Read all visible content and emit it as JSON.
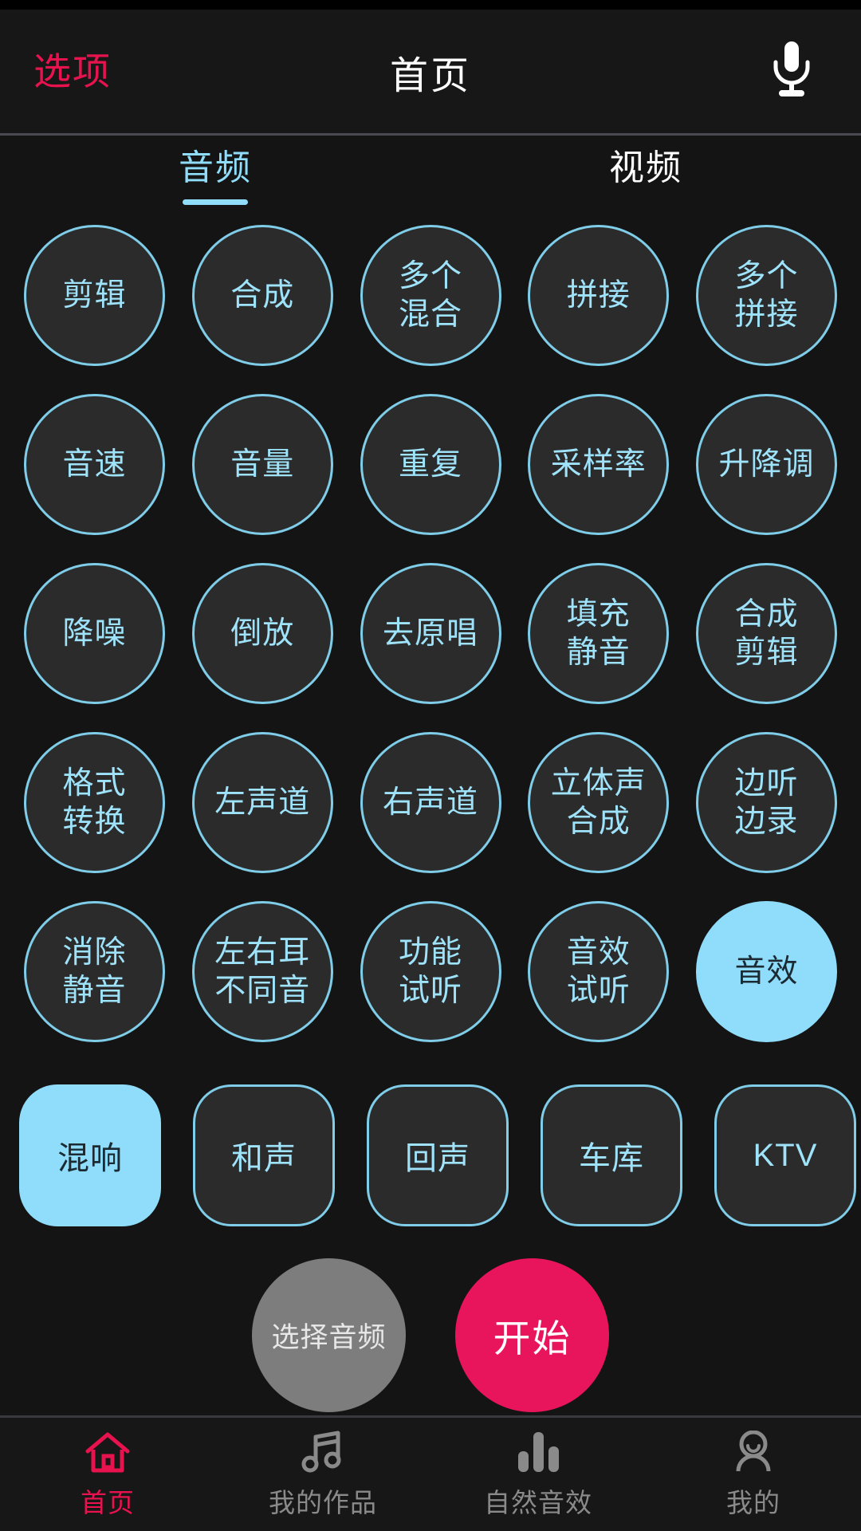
{
  "header": {
    "left_label": "选项",
    "title": "首页",
    "mic_icon": "microphone-icon",
    "options_color": "#E8134E"
  },
  "tabs": [
    {
      "label": "音频",
      "active": true
    },
    {
      "label": "视频",
      "active": false
    }
  ],
  "grid": {
    "rows": [
      [
        {
          "label": "剪辑",
          "selected": false
        },
        {
          "label": "合成",
          "selected": false
        },
        {
          "label": "多个\n混合",
          "selected": false
        },
        {
          "label": "拼接",
          "selected": false
        },
        {
          "label": "多个\n拼接",
          "selected": false
        }
      ],
      [
        {
          "label": "音速",
          "selected": false
        },
        {
          "label": "音量",
          "selected": false
        },
        {
          "label": "重复",
          "selected": false
        },
        {
          "label": "采样率",
          "selected": false
        },
        {
          "label": "升降调",
          "selected": false
        }
      ],
      [
        {
          "label": "降噪",
          "selected": false
        },
        {
          "label": "倒放",
          "selected": false
        },
        {
          "label": "去原唱",
          "selected": false
        },
        {
          "label": "填充\n静音",
          "selected": false
        },
        {
          "label": "合成\n剪辑",
          "selected": false
        }
      ],
      [
        {
          "label": "格式\n转换",
          "selected": false
        },
        {
          "label": "左声道",
          "selected": false
        },
        {
          "label": "右声道",
          "selected": false
        },
        {
          "label": "立体声\n合成",
          "selected": false
        },
        {
          "label": "边听\n边录",
          "selected": false
        }
      ],
      [
        {
          "label": "消除\n静音",
          "selected": false
        },
        {
          "label": "左右耳\n不同音",
          "selected": false
        },
        {
          "label": "功能\n试听",
          "selected": false
        },
        {
          "label": "音效\n试听",
          "selected": false
        },
        {
          "label": "音效",
          "selected": true
        }
      ]
    ]
  },
  "effects": [
    {
      "label": "混响",
      "selected": true
    },
    {
      "label": "和声",
      "selected": false
    },
    {
      "label": "回声",
      "selected": false
    },
    {
      "label": "车库",
      "selected": false
    },
    {
      "label": "KTV",
      "selected": false
    }
  ],
  "actions": {
    "pick_label": "选择音频",
    "start_label": "开始"
  },
  "bottom_nav": [
    {
      "label": "首页",
      "icon": "home-icon",
      "active": true
    },
    {
      "label": "我的作品",
      "icon": "music-note-icon",
      "active": false
    },
    {
      "label": "自然音效",
      "icon": "equalizer-bars-icon",
      "active": false
    },
    {
      "label": "我的",
      "icon": "person-icon",
      "active": false
    }
  ],
  "theme": {
    "accent_blue": "#8FDDFA",
    "accent_pink": "#E8134E",
    "start_pink": "#E8145C",
    "background": "#141414"
  }
}
